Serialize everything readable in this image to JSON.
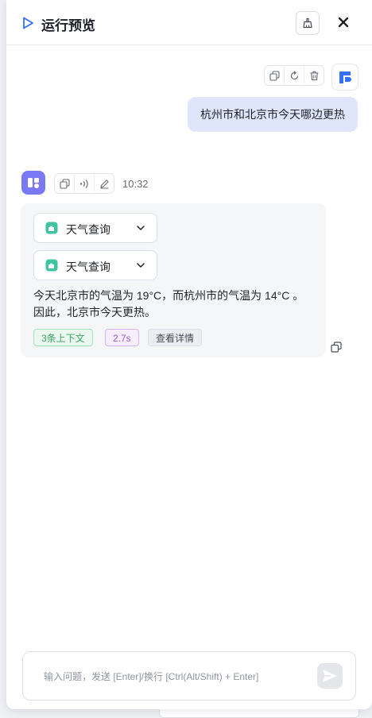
{
  "header": {
    "title": "运行预览",
    "play_icon": "play-icon",
    "clear_icon": "broom-icon",
    "close_icon": "close-icon"
  },
  "user_message": {
    "text": "杭州市和北京市今天哪边更热",
    "actions": [
      "copy-icon",
      "refresh-icon",
      "trash-icon"
    ],
    "avatar_icon": "app-logo-icon"
  },
  "bot_message": {
    "avatar_icon": "bot-avatar-icon",
    "actions": [
      "copy-icon",
      "speaker-icon",
      "edit-icon"
    ],
    "time": "10:32",
    "tool_calls": [
      {
        "label": "天气查询",
        "icon": "plugin-icon"
      },
      {
        "label": "天气查询",
        "icon": "plugin-icon"
      }
    ],
    "answer": "今天北京市的气温为 19°C，而杭州市的气温为 14°C 。因此，北京市今天更热。",
    "tags": {
      "context": "3条上下文",
      "duration": "2.7s",
      "details": "查看详情"
    }
  },
  "composer": {
    "placeholder": "输入问题，发送 [Enter]/换行 [Ctrl(Alt/Shift) + Enter]",
    "value": "",
    "send_icon": "send-icon"
  },
  "colors": {
    "accent": "#3370ff",
    "user_bubble": "#dfe6fb",
    "bot_card": "#f5f6f8",
    "tag_green": "#3aa461",
    "tag_purple": "#9d56d6"
  }
}
